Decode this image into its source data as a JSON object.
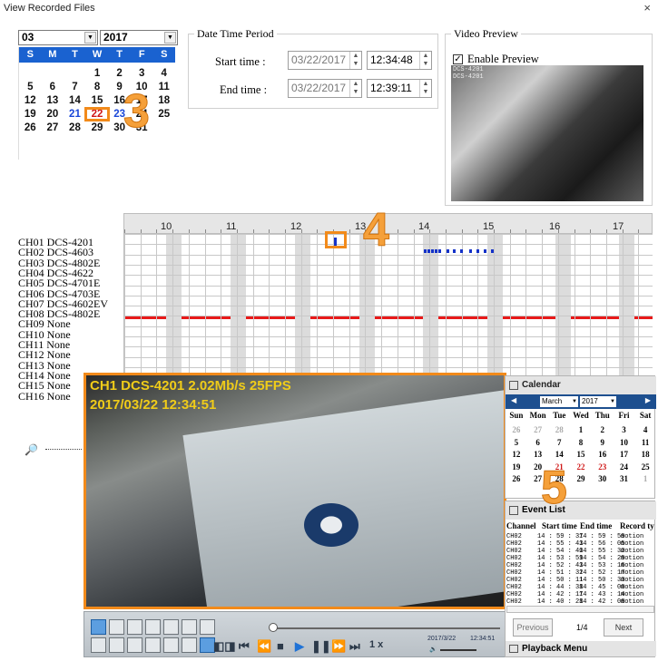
{
  "window": {
    "title": "View Recorded Files",
    "close_glyph": "×"
  },
  "date_select": {
    "month": "03",
    "year": "2017"
  },
  "mini_calendar": {
    "weekdays": [
      "S",
      "M",
      "T",
      "W",
      "T",
      "F",
      "S"
    ],
    "weeks": [
      [
        "",
        "",
        "",
        "1",
        "2",
        "3",
        "4"
      ],
      [
        "5",
        "6",
        "7",
        "8",
        "9",
        "10",
        "11"
      ],
      [
        "12",
        "13",
        "14",
        "15",
        "16",
        "17",
        "18"
      ],
      [
        "19",
        "20",
        "21",
        "22",
        "23",
        "24",
        "25"
      ],
      [
        "26",
        "27",
        "28",
        "29",
        "30",
        "31",
        ""
      ]
    ],
    "selected_day": "22",
    "blue_days": [
      "21",
      "23"
    ]
  },
  "period": {
    "title": "Date Time Period",
    "start_label": "Start time :",
    "start_date": "03/22/2017",
    "start_time": "12:34:48",
    "end_label": "End time :",
    "end_date": "03/22/2017",
    "end_time": "12:39:11"
  },
  "preview": {
    "title": "Video Preview",
    "enable_label": "Enable Preview",
    "enabled": true,
    "osd_line1": "DCS-4201",
    "osd_line2": "DCS-4201"
  },
  "timeline": {
    "hours": [
      "10",
      "11",
      "12",
      "13",
      "14",
      "15",
      "16",
      "17"
    ],
    "channels": [
      "CH01 DCS-4201",
      "CH02 DCS-4603",
      "CH03 DCS-4802E",
      "CH04 DCS-4622",
      "CH05 DCS-4701E",
      "CH06 DCS-4703E",
      "CH07 DCS-4602EV",
      "CH08 DCS-4802E",
      "CH09 None",
      "CH10 None",
      "CH11 None",
      "CH12 None",
      "CH13 None",
      "CH14 None",
      "CH15 None",
      "CH16 None"
    ]
  },
  "steps": {
    "three": "3",
    "four": "4",
    "five": "5"
  },
  "video": {
    "osd_info": "CH1 DCS-4201 2.02Mb/s 25FPS",
    "osd_time": "2017/03/22 12:34:51"
  },
  "playback": {
    "speed": "1 x",
    "date": "2017/3/22",
    "time": "12:34:51"
  },
  "calendar_panel": {
    "title": "Calendar",
    "month": "March",
    "year": "2017",
    "weekdays": [
      "Sun",
      "Mon",
      "Tue",
      "Wed",
      "Thu",
      "Fri",
      "Sat"
    ],
    "weeks": [
      [
        "26",
        "27",
        "28",
        "1",
        "2",
        "3",
        "4"
      ],
      [
        "5",
        "6",
        "7",
        "8",
        "9",
        "10",
        "11"
      ],
      [
        "12",
        "13",
        "14",
        "15",
        "16",
        "17",
        "18"
      ],
      [
        "19",
        "20",
        "21",
        "22",
        "23",
        "24",
        "25"
      ],
      [
        "26",
        "27",
        "28",
        "29",
        "30",
        "31",
        "1"
      ]
    ]
  },
  "event_list": {
    "title": "Event List",
    "columns": [
      "Channel",
      "Start time",
      "End time",
      "Record ty"
    ],
    "rows": [
      [
        "CH02",
        "14 : 59 : 37",
        "14 : 59 : 59",
        "motion"
      ],
      [
        "CH02",
        "14 : 55 : 43",
        "14 : 56 : 05",
        "motion"
      ],
      [
        "CH02",
        "14 : 54 : 40",
        "14 : 55 : 32",
        "motion"
      ],
      [
        "CH02",
        "14 : 53 : 59",
        "14 : 54 : 29",
        "motion"
      ],
      [
        "CH02",
        "14 : 52 : 43",
        "14 : 53 : 16",
        "motion"
      ],
      [
        "CH02",
        "14 : 51 : 32",
        "14 : 52 : 17",
        "motion"
      ],
      [
        "CH02",
        "14 : 50 : 11",
        "14 : 50 : 33",
        "motion"
      ],
      [
        "CH02",
        "14 : 44 : 38",
        "14 : 45 : 00",
        "motion"
      ],
      [
        "CH02",
        "14 : 42 : 17",
        "14 : 43 : 14",
        "motion"
      ],
      [
        "CH02",
        "14 : 40 : 28",
        "14 : 42 : 08",
        "motion"
      ]
    ],
    "previous_label": "Previous",
    "page": "1/4",
    "next_label": "Next",
    "menu_label": "Playback Menu"
  }
}
